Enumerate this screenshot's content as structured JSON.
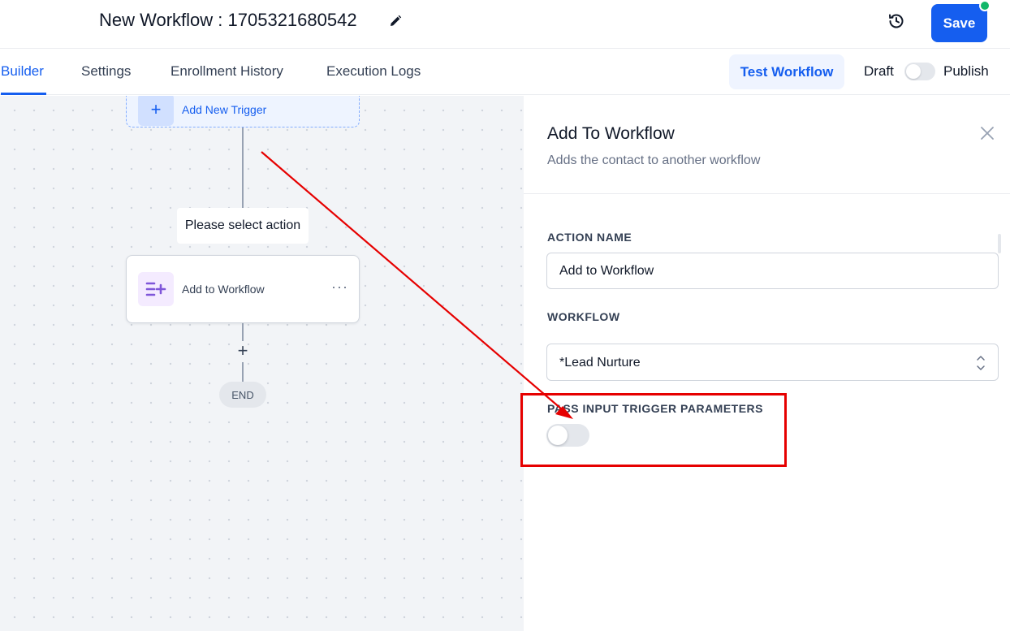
{
  "header": {
    "workflow_title": "New Workflow : 1705321680542",
    "edit_icon": "pencil-icon",
    "history_icon": "history-icon",
    "save_label": "Save",
    "status_dot_color": "#12b76a"
  },
  "tabs": [
    {
      "label": "Builder",
      "active": true
    },
    {
      "label": "Settings",
      "active": false
    },
    {
      "label": "Enrollment History",
      "active": false
    },
    {
      "label": "Execution Logs",
      "active": false
    }
  ],
  "toolbar": {
    "test_workflow_label": "Test Workflow",
    "draft_label": "Draft",
    "publish_label": "Publish",
    "published": false
  },
  "canvas": {
    "trigger_label": "Add New Trigger",
    "select_action_label": "Please select action",
    "action_card": {
      "label": "Add to Workflow",
      "icon": "list-add-icon",
      "more_icon": "more-horizontal-icon"
    },
    "add_step_symbol": "+",
    "end_label": "END"
  },
  "panel": {
    "title": "Add To Workflow",
    "subtitle": "Adds the contact to another workflow",
    "close_icon": "close-icon",
    "action_name_label": "ACTION NAME",
    "action_name_value": "Add to Workflow",
    "workflow_label": "WORKFLOW",
    "workflow_value": "*Lead Nurture",
    "pass_params_label": "PASS INPUT TRIGGER PARAMETERS",
    "pass_params_enabled": false
  },
  "colors": {
    "accent": "#155eef",
    "annotation": "#e60000",
    "action_icon": "#7f56d9"
  }
}
